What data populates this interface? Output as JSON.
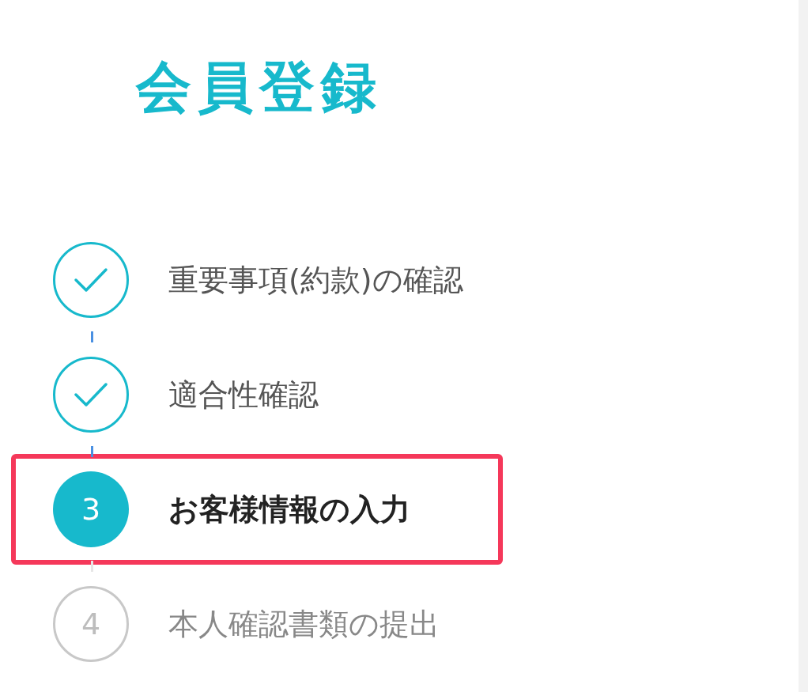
{
  "title": "会員登録",
  "steps": [
    {
      "kind": "done",
      "label": "重要事項(約款)の確認",
      "highlighted": false
    },
    {
      "kind": "done",
      "label": "適合性確認",
      "highlighted": false
    },
    {
      "kind": "current",
      "number": "3",
      "label": "お客様情報の入力",
      "highlighted": true
    },
    {
      "kind": "upcoming",
      "number": "4",
      "label": "本人確認書類の提出",
      "highlighted": false
    }
  ]
}
